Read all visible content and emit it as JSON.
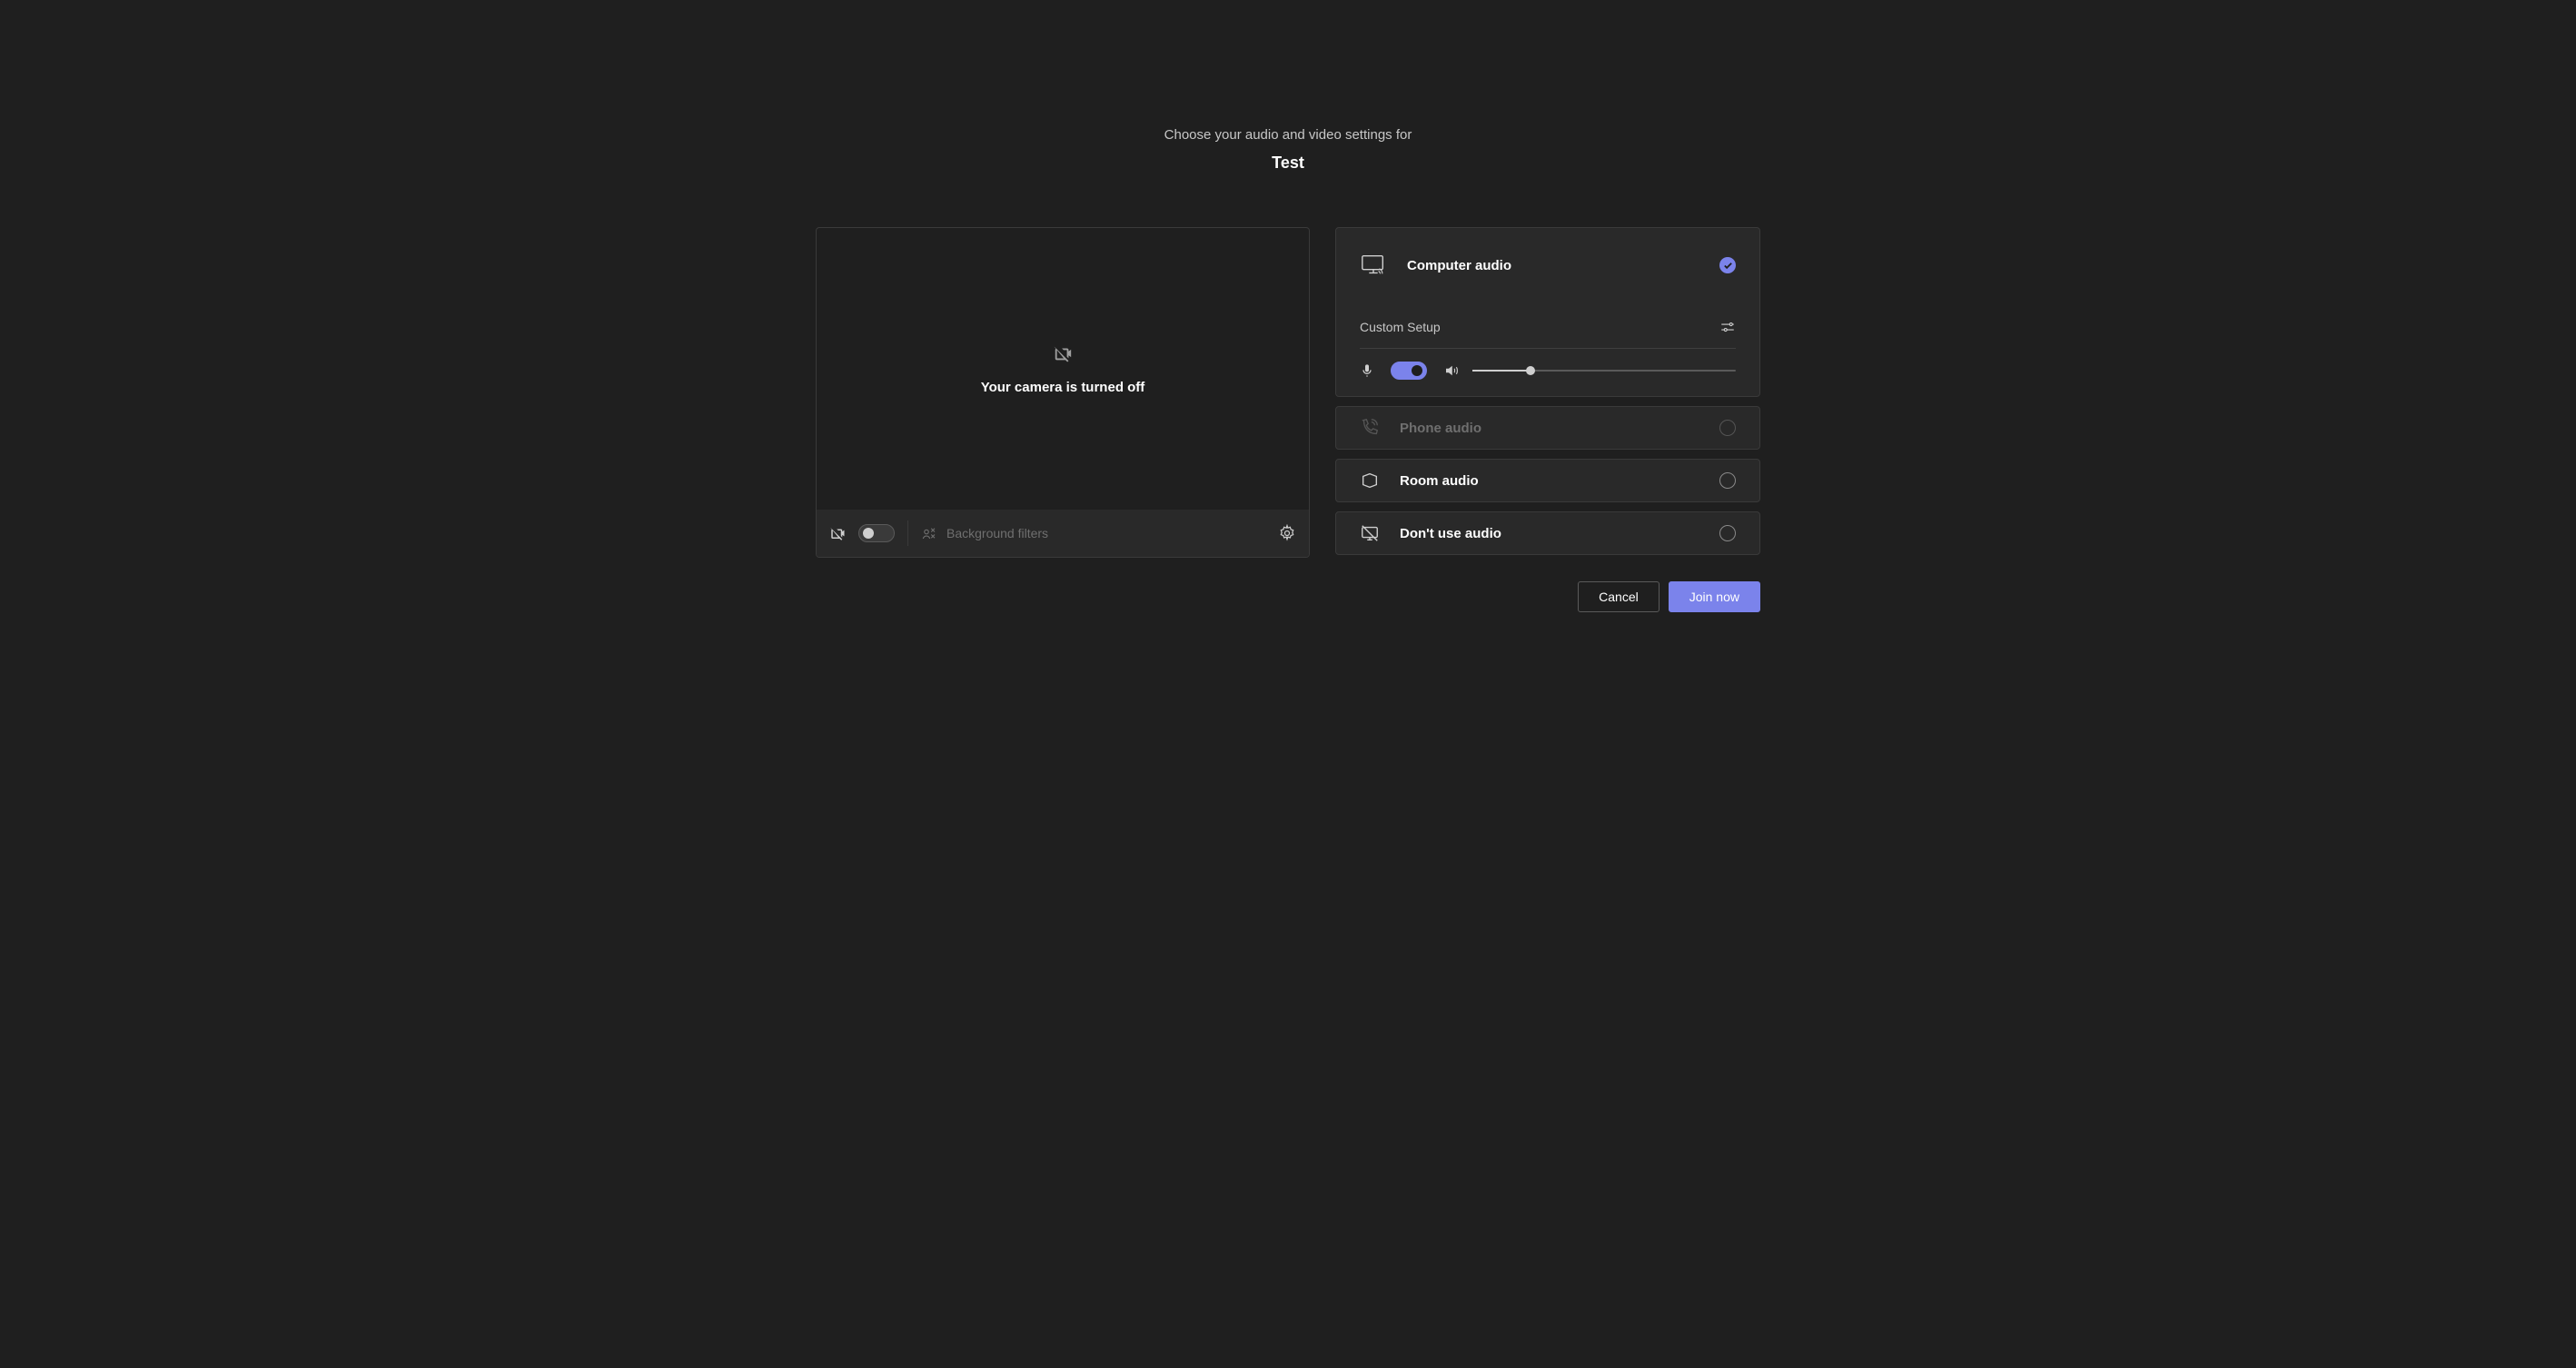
{
  "header": {
    "subtitle": "Choose your audio and video settings for",
    "title": "Test"
  },
  "video": {
    "status_text": "Your camera is turned off",
    "camera_toggle_on": false,
    "background_filters_label": "Background filters"
  },
  "audio": {
    "computer": {
      "label": "Computer audio",
      "selected": true
    },
    "custom_setup_label": "Custom Setup",
    "mic_toggle_on": true,
    "volume_percent": 22,
    "phone": {
      "label": "Phone audio",
      "enabled": false
    },
    "room": {
      "label": "Room audio"
    },
    "none": {
      "label": "Don't use audio"
    }
  },
  "footer": {
    "cancel": "Cancel",
    "join": "Join now"
  },
  "colors": {
    "accent": "#7b83eb"
  }
}
